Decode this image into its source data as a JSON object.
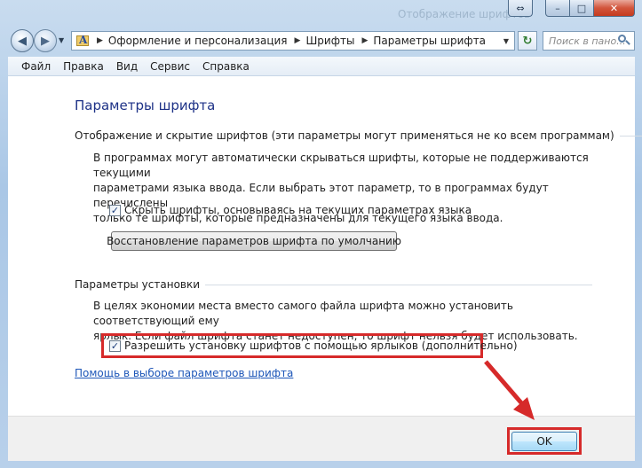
{
  "window": {
    "ghost_title": "Отображение шрифтов",
    "controls": {
      "extra": "⇔",
      "minimize": "–",
      "maximize": "□",
      "close": "✕"
    }
  },
  "address": {
    "breadcrumbs": [
      "Оформление и персонализация",
      "Шрифты",
      "Параметры шрифта"
    ],
    "search_placeholder": "Поиск в пано..."
  },
  "menu": [
    "Файл",
    "Правка",
    "Вид",
    "Сервис",
    "Справка"
  ],
  "page": {
    "title": "Параметры шрифта",
    "section1": {
      "heading": "Отображение и скрытие шрифтов (эти параметры могут применяться не ко всем программам)",
      "lines": [
        "В программах могут автоматически скрываться шрифты, которые не поддерживаются текущими",
        "параметрами языка ввода. Если выбрать этот параметр, то в программах будут перечислены",
        "только те шрифты, которые предназначены для текущего языка ввода."
      ],
      "checkbox_label": "Скрыть шрифты, основываясь на текущих параметрах языка",
      "checkbox_checked": true,
      "restore_button": "Восстановление параметров шрифта по умолчанию"
    },
    "section2": {
      "heading": "Параметры установки",
      "lines": [
        "В целях экономии места вместо самого файла шрифта можно установить соответствующий ему",
        "ярлык. Если файл шрифта станет недоступен, то шрифт нельзя будет использовать."
      ],
      "checkbox_label": "Разрешить установку шрифтов с помощью ярлыков (дополнительно)",
      "checkbox_checked": true
    },
    "help_link": "Помощь в выборе параметров шрифта"
  },
  "footer": {
    "ok_label": "OK"
  },
  "colors": {
    "highlight": "#d62a2a",
    "link": "#1d56b8",
    "title": "#1e3287"
  }
}
